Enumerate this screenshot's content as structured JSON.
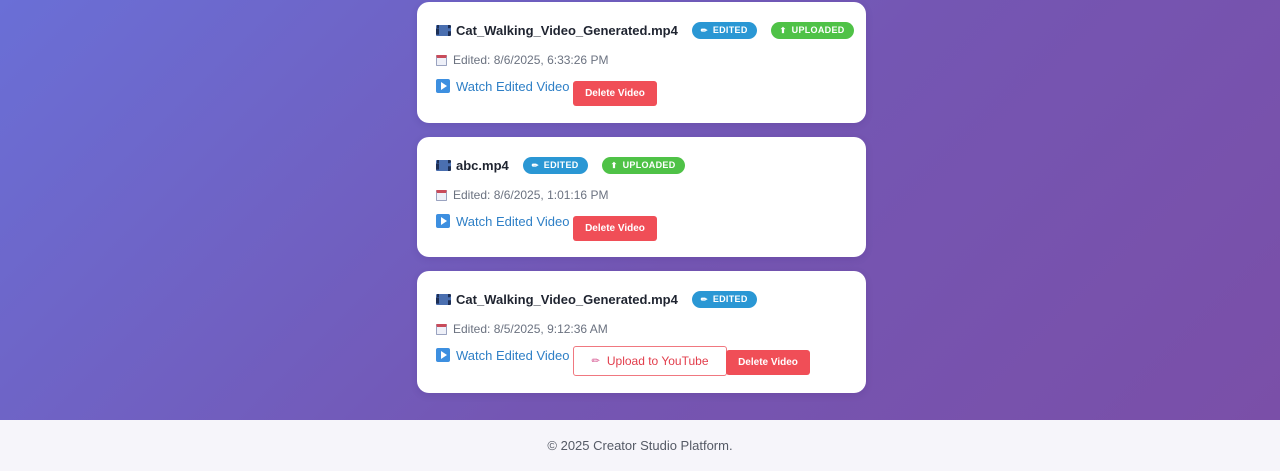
{
  "videos": [
    {
      "file_name": "Cat_Walking_Video_Generated.mp4",
      "badges": {
        "edited": "EDITED",
        "uploaded": "UPLOADED"
      },
      "edited_text": "Edited: 8/6/2025, 6:33:26 PM",
      "watch_label": "Watch Edited Video",
      "delete_label": "Delete Video"
    },
    {
      "file_name": "abc.mp4",
      "badges": {
        "edited": "EDITED",
        "uploaded": "UPLOADED"
      },
      "edited_text": "Edited: 8/6/2025, 1:01:16 PM",
      "watch_label": "Watch Edited Video",
      "delete_label": "Delete Video"
    },
    {
      "file_name": "Cat_Walking_Video_Generated.mp4",
      "badges": {
        "edited": "EDITED"
      },
      "edited_text": "Edited: 8/5/2025, 9:12:36 AM",
      "watch_label": "Watch Edited Video",
      "upload_label": "Upload to YouTube",
      "delete_label": "Delete Video"
    }
  ],
  "icons": {
    "file": "film-icon",
    "edited_badge": "pencil-icon",
    "uploaded_badge": "upload-icon",
    "date": "calendar-icon",
    "watch": "play-icon",
    "upload_button": "pencil-icon"
  },
  "colors": {
    "background_gradient_start": "#6a6fd6",
    "background_gradient_end": "#7a4fa8",
    "edited_badge": "#2a97d4",
    "uploaded_badge": "#4fc247",
    "delete_button": "#f04e57",
    "link": "#2e7fc6",
    "footer_bg": "#f6f5fa"
  },
  "footer": {
    "text": "© 2025 Creator Studio Platform."
  }
}
